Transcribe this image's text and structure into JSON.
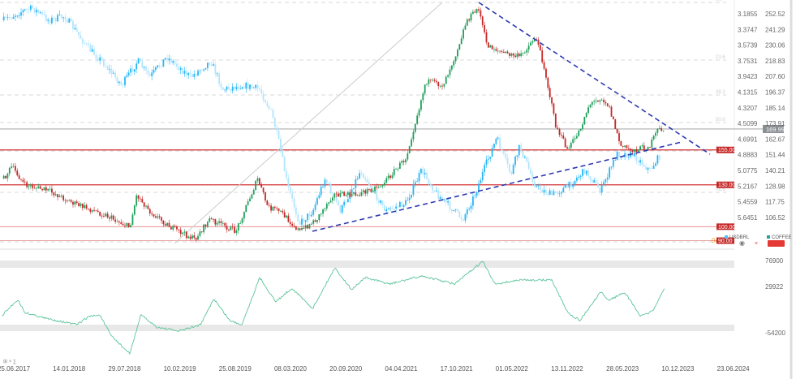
{
  "chart_data": {
    "type": "candlestick-overlay",
    "title": "USDBRL vs COFFEE",
    "legend": [
      {
        "name": "USDBRL",
        "color": "#4fc3f7"
      },
      {
        "name": "COFFEE",
        "color": "#26a69a"
      }
    ],
    "legend_placement": "right",
    "x_ticks": [
      "25.06.2017",
      "14.01.2018",
      "29.07.2018",
      "10.02.2019",
      "25.08.2019",
      "08.03.2020",
      "20.09.2020",
      "04.04.2021",
      "17.10.2021",
      "01.05.2022",
      "13.11.2022",
      "28.05.2023",
      "10.12.2023",
      "23.06.2024"
    ],
    "usdbrl_axis": {
      "ticks": [
        "3.1855",
        "3.3747",
        "3.5739",
        "3.7531",
        "3.9423",
        "4.1315",
        "4.3207",
        "4.5099",
        "4.6991",
        "4.8883",
        "5.0775",
        "5.2167",
        "5.4559",
        "5.6451"
      ],
      "inverted": true
    },
    "coffee_axis": {
      "ticks": [
        "252.52",
        "241.29",
        "230.06",
        "218.83",
        "207.60",
        "196.37",
        "185.14",
        "173.91",
        "162.67",
        "151.44",
        "140.21",
        "128.98",
        "117.75",
        "106.52"
      ]
    },
    "last_price": "169.99",
    "levels": [
      "155.00",
      "130.00",
      "100.00",
      "90.00"
    ],
    "fib_levels": [
      "0.0",
      "23.6",
      "38.2",
      "50.0",
      "61.8",
      "78.6"
    ],
    "fib_marker": "04",
    "coffee": [
      [
        2017.38,
        134.5
      ],
      [
        2017.46,
        143.2
      ],
      [
        2017.59,
        129.9
      ],
      [
        2017.83,
        125.8
      ],
      [
        2018.07,
        117.1
      ],
      [
        2018.4,
        108.3
      ],
      [
        2018.64,
        99.6
      ],
      [
        2018.71,
        122.9
      ],
      [
        2018.84,
        111.2
      ],
      [
        2019.05,
        99.6
      ],
      [
        2019.29,
        90.9
      ],
      [
        2019.44,
        105.4
      ],
      [
        2019.7,
        96.7
      ],
      [
        2019.92,
        134.5
      ],
      [
        2020.02,
        114.1
      ],
      [
        2020.14,
        111.2
      ],
      [
        2020.34,
        96.7
      ],
      [
        2020.51,
        105.4
      ],
      [
        2020.67,
        122.9
      ],
      [
        2020.91,
        122.9
      ],
      [
        2021.16,
        129.9
      ],
      [
        2021.4,
        149.0
      ],
      [
        2021.56,
        192.6
      ],
      [
        2021.6,
        204.3
      ],
      [
        2021.77,
        201.4
      ],
      [
        2021.89,
        221.7
      ],
      [
        2022.01,
        247.9
      ],
      [
        2022.13,
        256.6
      ],
      [
        2022.21,
        230.4
      ],
      [
        2022.37,
        224.6
      ],
      [
        2022.54,
        221.7
      ],
      [
        2022.7,
        236.2
      ],
      [
        2022.78,
        215.9
      ],
      [
        2022.9,
        172.3
      ],
      [
        2023.02,
        154.8
      ],
      [
        2023.14,
        169.4
      ],
      [
        2023.23,
        186.8
      ],
      [
        2023.35,
        192.6
      ],
      [
        2023.43,
        186.8
      ],
      [
        2023.55,
        157.8
      ],
      [
        2023.67,
        154.8
      ],
      [
        2023.84,
        157.8
      ],
      [
        2023.92,
        169.4
      ],
      [
        2023.99,
        169.99
      ]
    ],
    "usdbrl": [
      [
        2017.38,
        3.264
      ],
      [
        2017.54,
        3.166
      ],
      [
        2017.67,
        3.117
      ],
      [
        2017.83,
        3.264
      ],
      [
        2017.99,
        3.215
      ],
      [
        2018.23,
        3.607
      ],
      [
        2018.36,
        3.754
      ],
      [
        2018.56,
        4.048
      ],
      [
        2018.72,
        3.754
      ],
      [
        2018.84,
        3.95
      ],
      [
        2019.01,
        3.705
      ],
      [
        2019.25,
        3.95
      ],
      [
        2019.45,
        3.754
      ],
      [
        2019.57,
        4.097
      ],
      [
        2019.78,
        4.048
      ],
      [
        2019.94,
        4.097
      ],
      [
        2020.06,
        4.391
      ],
      [
        2020.14,
        4.783
      ],
      [
        2020.22,
        5.273
      ],
      [
        2020.34,
        5.714
      ],
      [
        2020.47,
        5.567
      ],
      [
        2020.59,
        5.175
      ],
      [
        2020.75,
        5.567
      ],
      [
        2020.95,
        5.077
      ],
      [
        2021.2,
        5.567
      ],
      [
        2021.4,
        5.469
      ],
      [
        2021.56,
        5.077
      ],
      [
        2021.72,
        5.371
      ],
      [
        2021.97,
        5.665
      ],
      [
        2022.09,
        5.371
      ],
      [
        2022.21,
        4.979
      ],
      [
        2022.31,
        4.685
      ],
      [
        2022.45,
        5.126
      ],
      [
        2022.54,
        4.783
      ],
      [
        2022.7,
        5.273
      ],
      [
        2022.86,
        5.371
      ],
      [
        2023.02,
        5.273
      ],
      [
        2023.19,
        5.077
      ],
      [
        2023.35,
        5.322
      ],
      [
        2023.51,
        4.881
      ],
      [
        2023.67,
        4.881
      ],
      [
        2023.84,
        5.077
      ],
      [
        2023.95,
        4.881
      ]
    ],
    "oscillator": {
      "label": "⊞ × ∑",
      "axis_ticks": [
        "76900",
        "29922",
        "-54200"
      ],
      "points": [
        [
          2017.36,
          -24420
        ],
        [
          2017.52,
          5380
        ],
        [
          2017.59,
          -18460
        ],
        [
          2017.79,
          -28890
        ],
        [
          2018.11,
          -40810
        ],
        [
          2018.23,
          -25910
        ],
        [
          2018.34,
          -22930
        ],
        [
          2018.45,
          -60180
        ],
        [
          2018.64,
          -94450
        ],
        [
          2018.75,
          -22930
        ],
        [
          2018.91,
          -45280
        ],
        [
          2019.13,
          -52730
        ],
        [
          2019.35,
          -40810
        ],
        [
          2019.48,
          6870
        ],
        [
          2019.64,
          -33360
        ],
        [
          2019.76,
          -40810
        ],
        [
          2019.94,
          45610
        ],
        [
          2020.1,
          910
        ],
        [
          2020.26,
          26240
        ],
        [
          2020.47,
          -11010
        ],
        [
          2020.69,
          63490
        ],
        [
          2020.86,
          23260
        ],
        [
          2020.99,
          45610
        ],
        [
          2021.24,
          33690
        ],
        [
          2021.56,
          48590
        ],
        [
          2021.89,
          33690
        ],
        [
          2022.17,
          75410
        ],
        [
          2022.29,
          33690
        ],
        [
          2022.54,
          41140
        ],
        [
          2022.86,
          41140
        ],
        [
          2023.02,
          -18460
        ],
        [
          2023.14,
          -33360
        ],
        [
          2023.35,
          18790
        ],
        [
          2023.43,
          3890
        ],
        [
          2023.59,
          18790
        ],
        [
          2023.75,
          -25910
        ],
        [
          2023.87,
          -15480
        ],
        [
          2023.99,
          26240
        ]
      ]
    }
  }
}
